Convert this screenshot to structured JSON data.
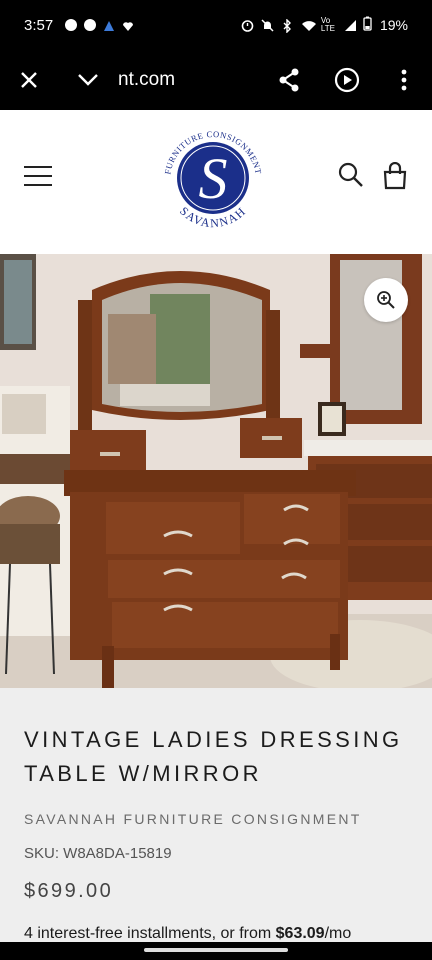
{
  "status_bar": {
    "time": "3:57",
    "battery": "19%",
    "icons_left": [
      "chat-icon",
      "messenger-icon",
      "drive-icon",
      "heart-icon"
    ],
    "icons_right": [
      "alarm-icon",
      "mute-icon",
      "bluetooth-icon",
      "wifi-icon",
      "volte-icon",
      "signal-icon",
      "battery-icon"
    ]
  },
  "browser": {
    "url_fragment": "nt.com",
    "icons": [
      "close-icon",
      "chevron-down-icon",
      "share-icon",
      "play-icon",
      "more-vert-icon"
    ]
  },
  "header": {
    "logo_arc_top": "FURNITURE CONSIGNMENT",
    "logo_letter": "S",
    "logo_arc_bottom": "SAVANNAH",
    "brand_color": "#1b2f8a"
  },
  "product": {
    "title": "VINTAGE LADIES DRESSING TABLE W/MIRROR",
    "vendor": "SAVANNAH FURNITURE CONSIGNMENT",
    "sku": "SKU: W8A8DA-15819",
    "price": "$699.00",
    "installments_prefix": "4 interest-free installments, or from ",
    "installments_amount": "$63.09",
    "installments_suffix": "/mo"
  }
}
